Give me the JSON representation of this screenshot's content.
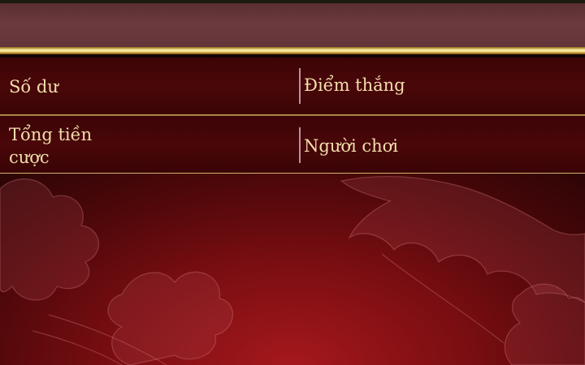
{
  "stats": {
    "balance_label": "Số dư",
    "winning_points_label": "Điểm thắng",
    "total_bet_label": "Tổng tiền cược",
    "players_label": "Người chơi"
  },
  "colors": {
    "gold": "#f4dc86",
    "label_text": "#f3deae",
    "background_red": "#a5181c",
    "row_dark": "#4a0709"
  }
}
